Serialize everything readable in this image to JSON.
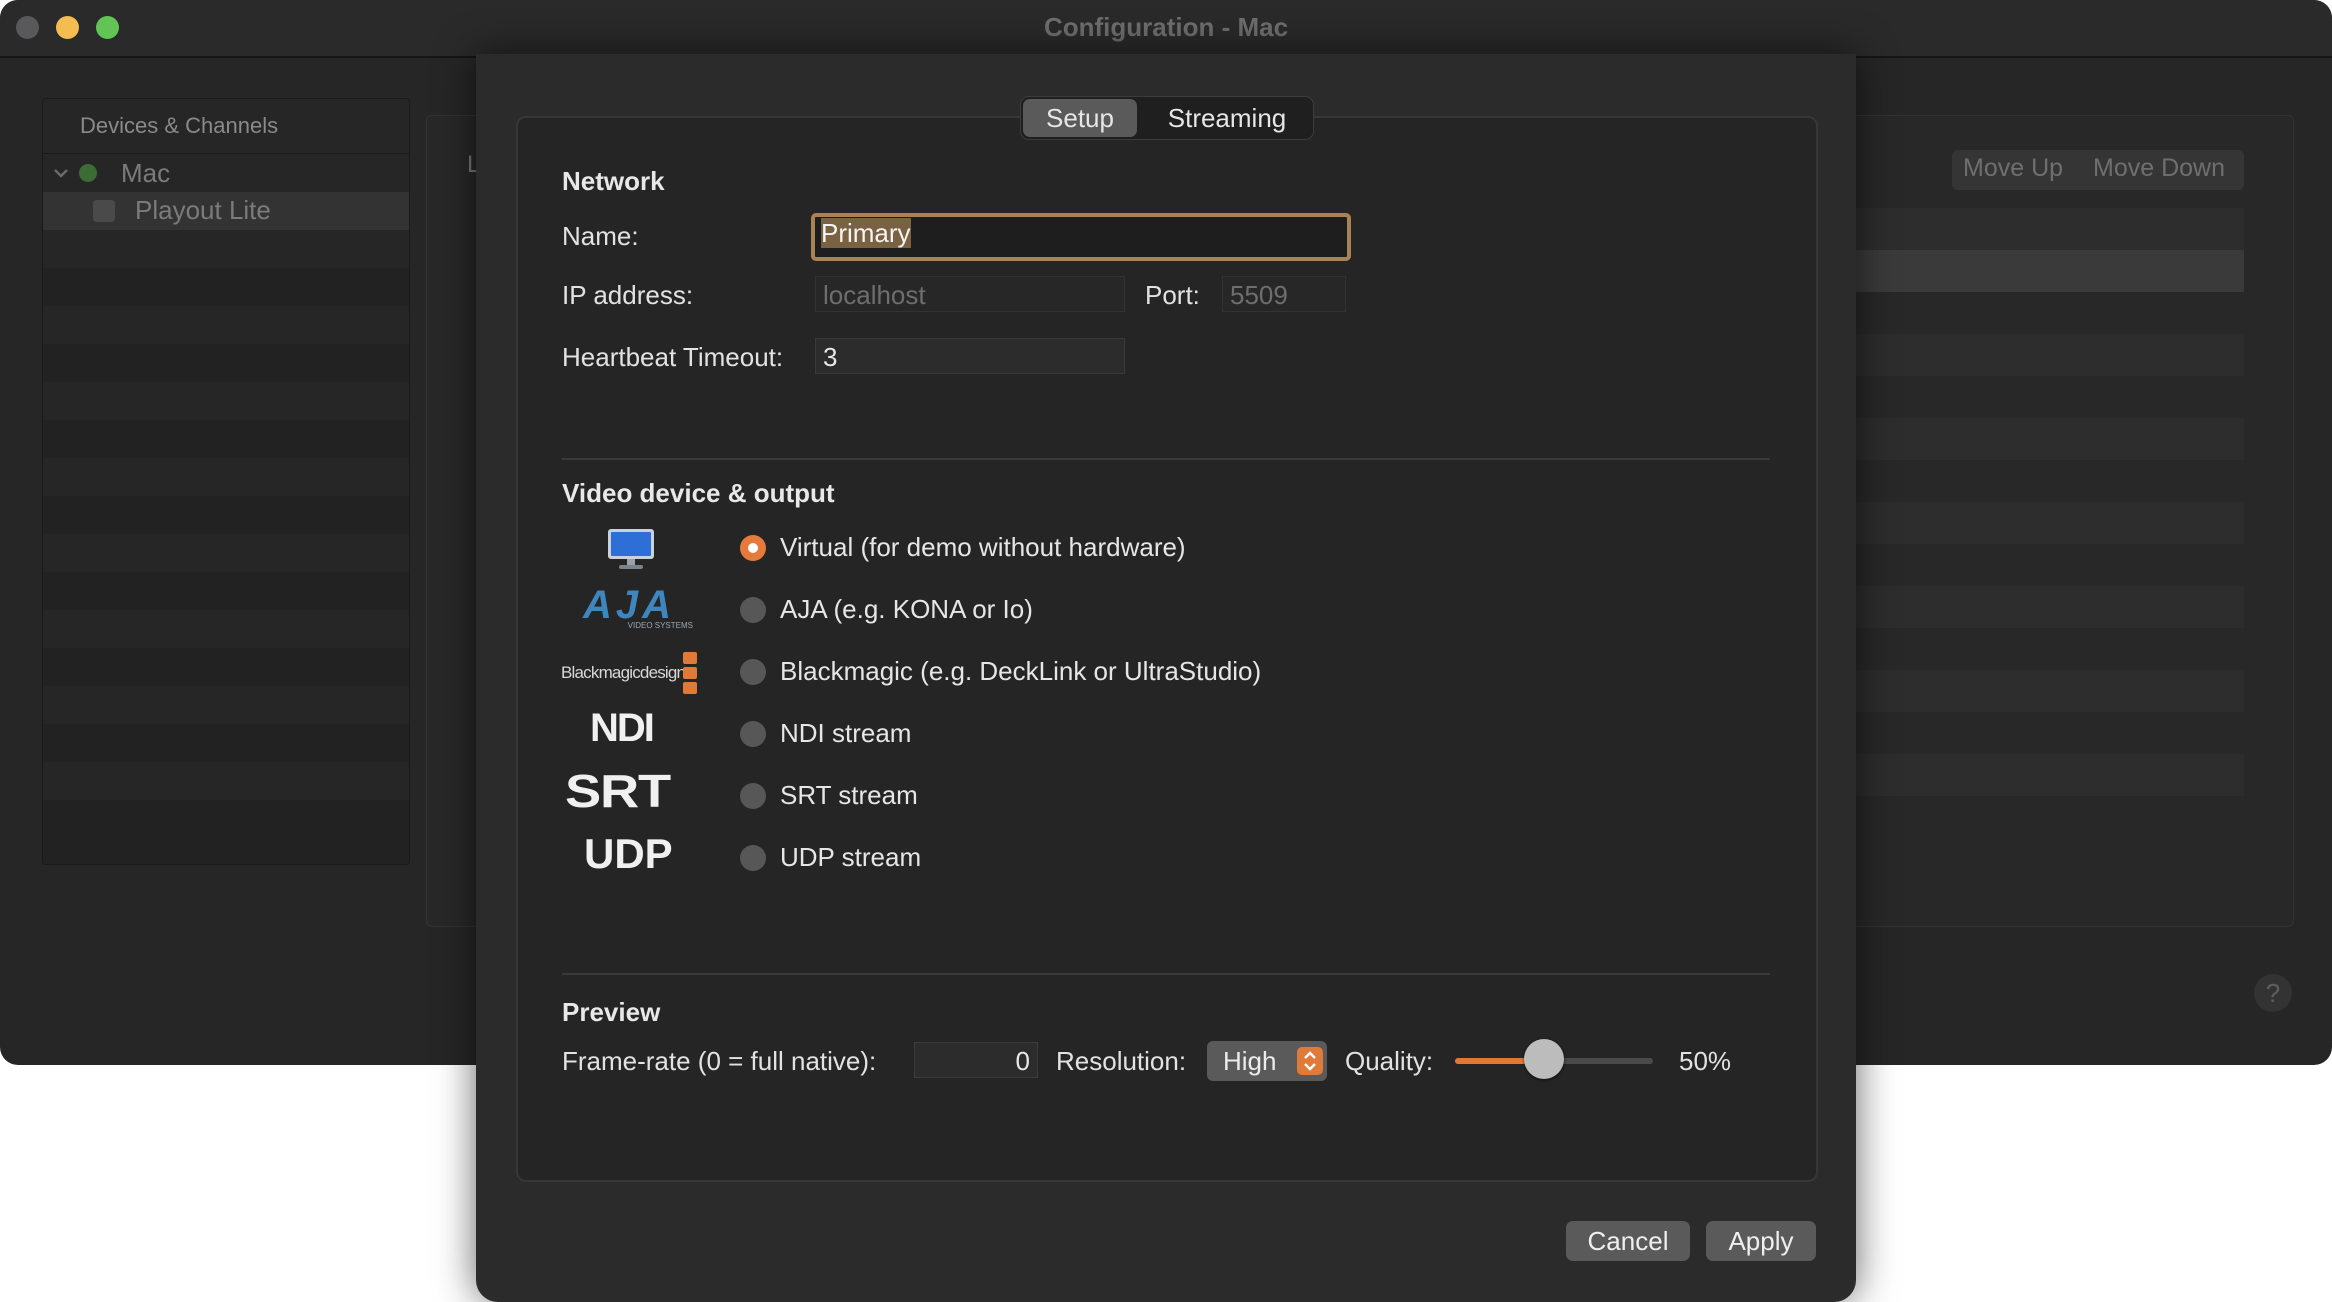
{
  "window": {
    "title": "Configuration - Mac"
  },
  "sidebar": {
    "header": "Devices & Channels",
    "device": {
      "name": "Mac",
      "status_color": "#3c6b33"
    },
    "channel": {
      "name": "Playout Lite"
    }
  },
  "background_panel": {
    "edge_text": "L",
    "move_up": "Move Up",
    "move_down": "Move Down",
    "help": "?"
  },
  "tabs": {
    "setup": "Setup",
    "streaming": "Streaming",
    "selected": "Setup"
  },
  "network": {
    "title": "Network",
    "name_label": "Name:",
    "name_value": "Primary",
    "ip_label": "IP address:",
    "ip_placeholder": "localhost",
    "port_label": "Port:",
    "port_placeholder": "5509",
    "heartbeat_label": "Heartbeat Timeout:",
    "heartbeat_value": "3"
  },
  "video": {
    "title": "Video device & output",
    "options": [
      {
        "label": "Virtual (for demo without hardware)",
        "icon": "monitor-icon",
        "selected": true
      },
      {
        "label": "AJA (e.g. KONA or Io)",
        "icon": "aja-logo",
        "selected": false
      },
      {
        "label": "Blackmagic (e.g. DeckLink or UltraStudio)",
        "icon": "blackmagic-logo",
        "selected": false
      },
      {
        "label": "NDI stream",
        "icon": "ndi-logo",
        "selected": false
      },
      {
        "label": "SRT stream",
        "icon": "srt-logo",
        "selected": false
      },
      {
        "label": "UDP stream",
        "icon": "udp-logo",
        "selected": false
      }
    ],
    "logos": {
      "aja": "AJA",
      "aja_sub": "VIDEO SYSTEMS",
      "blackmagic": "Blackmagicdesign",
      "ndi": "NDI",
      "srt": "SRT",
      "udp": "UDP"
    }
  },
  "preview": {
    "title": "Preview",
    "framerate_label": "Frame-rate (0 = full native):",
    "framerate_value": "0",
    "resolution_label": "Resolution:",
    "resolution_value": "High",
    "quality_label": "Quality:",
    "quality_value": "50%",
    "quality_fraction": 0.5
  },
  "buttons": {
    "cancel": "Cancel",
    "apply": "Apply"
  },
  "colors": {
    "accent": "#e47b3c",
    "focus_ring": "#a88455"
  }
}
